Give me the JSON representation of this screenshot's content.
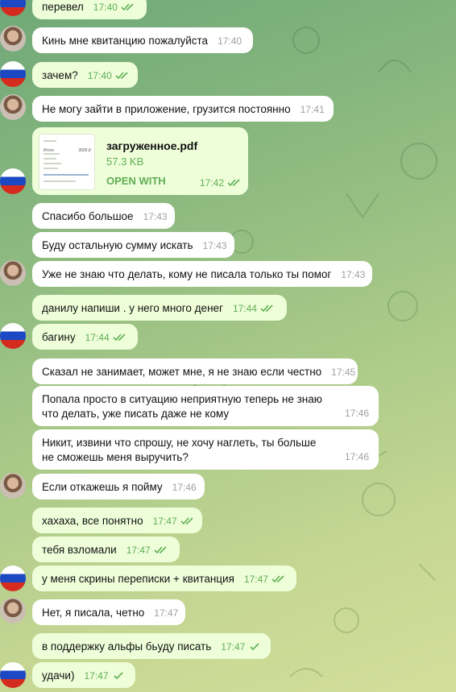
{
  "messages": [
    {
      "id": "m1",
      "dir": "out",
      "text": "перевел",
      "time": "17:40"
    },
    {
      "id": "m2",
      "dir": "in",
      "text": "Кинь мне квитанцию пожалуйста",
      "time": "17:40"
    },
    {
      "id": "m3",
      "dir": "out",
      "text": "зачем?",
      "time": "17:40"
    },
    {
      "id": "m4",
      "dir": "in",
      "text": "Не могу зайти в приложение, грузится постоянно",
      "time": "17:41"
    },
    {
      "id": "m5",
      "dir": "out",
      "file": {
        "name": "загруженное.pdf",
        "size": "57.3 KB",
        "action": "OPEN WITH"
      },
      "time": "17:42"
    },
    {
      "id": "m6",
      "dir": "in",
      "text": "Спасибо большое",
      "time": "17:43"
    },
    {
      "id": "m7",
      "dir": "in",
      "text": "Буду остальную сумму искать",
      "time": "17:43"
    },
    {
      "id": "m8",
      "dir": "in",
      "text": "Уже не знаю что делать, кому не писала только ты помог",
      "time": "17:43"
    },
    {
      "id": "m9",
      "dir": "out",
      "text": "данилу напиши . у него много денег",
      "time": "17:44"
    },
    {
      "id": "m10",
      "dir": "out",
      "text": "багину",
      "time": "17:44"
    },
    {
      "id": "m11",
      "dir": "in",
      "text": "Сказал не занимает, может мне, я не знаю если честно",
      "time": "17:45"
    },
    {
      "id": "m12",
      "dir": "in",
      "text": "Попала просто в ситуацию неприятную теперь не знаю что делать, уже писать даже не кому",
      "time": "17:46"
    },
    {
      "id": "m13",
      "dir": "in",
      "text": "Никит, извини что спрошу, не хочу наглеть, ты больше не сможешь меня выручить?",
      "time": "17:46"
    },
    {
      "id": "m14",
      "dir": "in",
      "text": "Если откажешь я пойму",
      "time": "17:46"
    },
    {
      "id": "m15",
      "dir": "out",
      "text": "хахаха, все понятно",
      "time": "17:47"
    },
    {
      "id": "m16",
      "dir": "out",
      "text": "тебя взломали",
      "time": "17:47"
    },
    {
      "id": "m17",
      "dir": "out",
      "text": "у меня скрины переписки + квитанция",
      "time": "17:47"
    },
    {
      "id": "m18",
      "dir": "in",
      "text": "Нет, я писала, четно",
      "time": "17:47"
    },
    {
      "id": "m19",
      "dir": "out",
      "text": "в поддержку альфы бьуду писать",
      "time": "17:47"
    },
    {
      "id": "m20",
      "dir": "out",
      "text": "удачи)",
      "time": "17:47"
    }
  ],
  "pdf_preview": {
    "label": "Итого",
    "amount": "3500 ₽"
  },
  "colors": {
    "incoming": "#ffffff",
    "outgoing": "#eefed9",
    "accent": "#5fae55",
    "background": "#8bb87f"
  },
  "avatars": {
    "self": "russian-flag",
    "contact": "woman-photo"
  }
}
